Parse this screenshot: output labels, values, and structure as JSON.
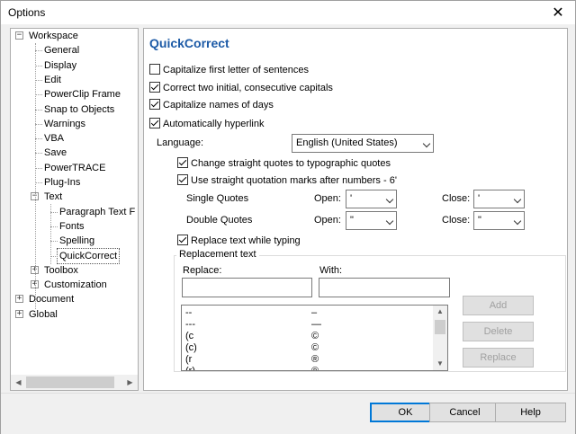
{
  "window": {
    "title": "Options",
    "close_glyph": "✕"
  },
  "tree": {
    "items": [
      {
        "label": "Workspace",
        "expander": "−"
      },
      {
        "label": "General"
      },
      {
        "label": "Display"
      },
      {
        "label": "Edit"
      },
      {
        "label": "PowerClip Frame"
      },
      {
        "label": "Snap to Objects"
      },
      {
        "label": "Warnings"
      },
      {
        "label": "VBA"
      },
      {
        "label": "Save"
      },
      {
        "label": "PowerTRACE"
      },
      {
        "label": "Plug-Ins"
      },
      {
        "label": "Text",
        "expander": "−"
      },
      {
        "label": "Paragraph Text F"
      },
      {
        "label": "Fonts"
      },
      {
        "label": "Spelling"
      },
      {
        "label": "QuickCorrect",
        "selected": true
      },
      {
        "label": "Toolbox",
        "expander": "+"
      },
      {
        "label": "Customization",
        "expander": "+"
      },
      {
        "label": "Document",
        "expander": "+"
      },
      {
        "label": "Global",
        "expander": "+"
      }
    ],
    "scroll_left": "◀",
    "scroll_right": "▶"
  },
  "panel": {
    "title": "QuickCorrect",
    "capitalize_first": {
      "label": "Capitalize first letter of sentences",
      "checked": false
    },
    "correct_two_initial": {
      "label": "Correct two initial, consecutive capitals",
      "checked": true
    },
    "capitalize_days": {
      "label": "Capitalize names of days",
      "checked": true
    },
    "auto_hyperlink": {
      "label": "Automatically hyperlink",
      "checked": true
    },
    "language_label": "Language:",
    "language_value": "English (United States)",
    "change_quotes": {
      "label": "Change straight quotes to typographic quotes",
      "checked": true
    },
    "straight_after_numbers": {
      "label": "Use straight quotation marks after numbers - 6'",
      "checked": true
    },
    "single_quotes_label": "Single Quotes",
    "double_quotes_label": "Double Quotes",
    "open_label": "Open:",
    "close_label": "Close:",
    "single_open": "'",
    "single_close": "'",
    "double_open": "\"",
    "double_close": "\"",
    "replace_while_typing": {
      "label": "Replace text while typing",
      "checked": true
    },
    "replacement_group": "Replacement text",
    "replace_label": "Replace:",
    "with_label": "With:",
    "list": [
      {
        "replace": "--",
        "with": "–"
      },
      {
        "replace": "---",
        "with": "—"
      },
      {
        "replace": "(c",
        "with": "©"
      },
      {
        "replace": "(c)",
        "with": "©"
      },
      {
        "replace": "(r",
        "with": "®"
      },
      {
        "replace": "(r)",
        "with": "®"
      }
    ],
    "add_label": "Add",
    "delete_label": "Delete",
    "replace_button_label": "Replace"
  },
  "footer": {
    "ok": "OK",
    "cancel": "Cancel",
    "help": "Help"
  }
}
